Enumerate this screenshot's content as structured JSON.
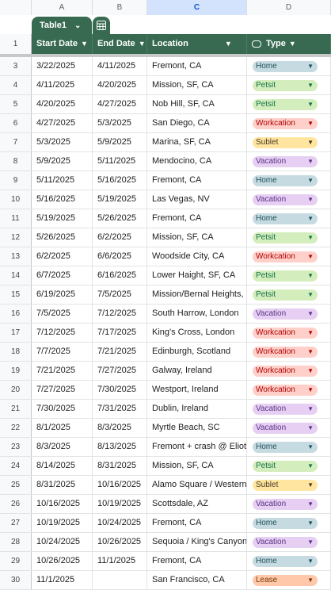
{
  "columns": [
    "A",
    "B",
    "C",
    "D"
  ],
  "table": {
    "name": "Table1"
  },
  "header": {
    "row_number": "1",
    "start": "Start Date",
    "end": "End Date",
    "location": "Location",
    "type": "Type"
  },
  "type_colors": {
    "Home": {
      "bg": "#c6dbe1",
      "fg": "#1f4f5b"
    },
    "Petsit": {
      "bg": "#d4edbc",
      "fg": "#11734b"
    },
    "Workcation": {
      "bg": "#ffcfc9",
      "fg": "#b10202"
    },
    "Sublet": {
      "bg": "#ffe5a0",
      "fg": "#473822"
    },
    "Vacation": {
      "bg": "#e6cff2",
      "fg": "#5a3286"
    },
    "Lease": {
      "bg": "#ffc8aa",
      "fg": "#753800"
    }
  },
  "rows": [
    {
      "n": "3",
      "start": "3/22/2025",
      "end": "4/11/2025",
      "location": "Fremont, CA",
      "type": "Home"
    },
    {
      "n": "4",
      "start": "4/11/2025",
      "end": "4/20/2025",
      "location": "Mission, SF, CA",
      "type": "Petsit"
    },
    {
      "n": "5",
      "start": "4/20/2025",
      "end": "4/27/2025",
      "location": "Nob Hill, SF, CA",
      "type": "Petsit"
    },
    {
      "n": "6",
      "start": "4/27/2025",
      "end": "5/3/2025",
      "location": "San Diego, CA",
      "type": "Workcation"
    },
    {
      "n": "7",
      "start": "5/3/2025",
      "end": "5/9/2025",
      "location": "Marina, SF, CA",
      "type": "Sublet"
    },
    {
      "n": "8",
      "start": "5/9/2025",
      "end": "5/11/2025",
      "location": "Mendocino, CA",
      "type": "Vacation"
    },
    {
      "n": "9",
      "start": "5/11/2025",
      "end": "5/16/2025",
      "location": "Fremont, CA",
      "type": "Home"
    },
    {
      "n": "10",
      "start": "5/16/2025",
      "end": "5/19/2025",
      "location": "Las Vegas, NV",
      "type": "Vacation"
    },
    {
      "n": "11",
      "start": "5/19/2025",
      "end": "5/26/2025",
      "location": "Fremont, CA",
      "type": "Home"
    },
    {
      "n": "12",
      "start": "5/26/2025",
      "end": "6/2/2025",
      "location": "Mission, SF, CA",
      "type": "Petsit"
    },
    {
      "n": "13",
      "start": "6/2/2025",
      "end": "6/6/2025",
      "location": "Woodside City, CA",
      "type": "Workcation"
    },
    {
      "n": "14",
      "start": "6/7/2025",
      "end": "6/16/2025",
      "location": "Lower Haight, SF, CA",
      "type": "Petsit"
    },
    {
      "n": "15",
      "start": "6/19/2025",
      "end": "7/5/2025",
      "location": "Mission/Bernal Heights, S",
      "type": "Petsit"
    },
    {
      "n": "16",
      "start": "7/5/2025",
      "end": "7/12/2025",
      "location": "South Harrow, London",
      "type": "Vacation"
    },
    {
      "n": "17",
      "start": "7/12/2025",
      "end": "7/17/2025",
      "location": "King's Cross, London",
      "type": "Workcation"
    },
    {
      "n": "18",
      "start": "7/7/2025",
      "end": "7/21/2025",
      "location": "Edinburgh, Scotland",
      "type": "Workcation"
    },
    {
      "n": "19",
      "start": "7/21/2025",
      "end": "7/27/2025",
      "location": "Galway, Ireland",
      "type": "Workcation"
    },
    {
      "n": "20",
      "start": "7/27/2025",
      "end": "7/30/2025",
      "location": "Westport, Ireland",
      "type": "Workcation"
    },
    {
      "n": "21",
      "start": "7/30/2025",
      "end": "7/31/2025",
      "location": "Dublin, Ireland",
      "type": "Vacation"
    },
    {
      "n": "22",
      "start": "8/1/2025",
      "end": "8/3/2025",
      "location": "Myrtle Beach, SC",
      "type": "Vacation"
    },
    {
      "n": "23",
      "start": "8/3/2025",
      "end": "8/13/2025",
      "location": "Fremont + crash @ Eliot's",
      "type": "Home"
    },
    {
      "n": "24",
      "start": "8/14/2025",
      "end": "8/31/2025",
      "location": "Mission, SF, CA",
      "type": "Petsit"
    },
    {
      "n": "25",
      "start": "8/31/2025",
      "end": "10/16/2025",
      "location": "Alamo Square / Western A",
      "type": "Sublet"
    },
    {
      "n": "26",
      "start": "10/16/2025",
      "end": "10/19/2025",
      "location": "Scottsdale, AZ",
      "type": "Vacation"
    },
    {
      "n": "27",
      "start": "10/19/2025",
      "end": "10/24/2025",
      "location": "Fremont, CA",
      "type": "Home"
    },
    {
      "n": "28",
      "start": "10/24/2025",
      "end": "10/26/2025",
      "location": "Sequoia / King's Canyon",
      "type": "Vacation"
    },
    {
      "n": "29",
      "start": "10/26/2025",
      "end": "11/1/2025",
      "location": "Fremont, CA",
      "type": "Home"
    },
    {
      "n": "30",
      "start": "11/1/2025",
      "end": "",
      "location": "San Francisco, CA",
      "type": "Lease"
    }
  ]
}
